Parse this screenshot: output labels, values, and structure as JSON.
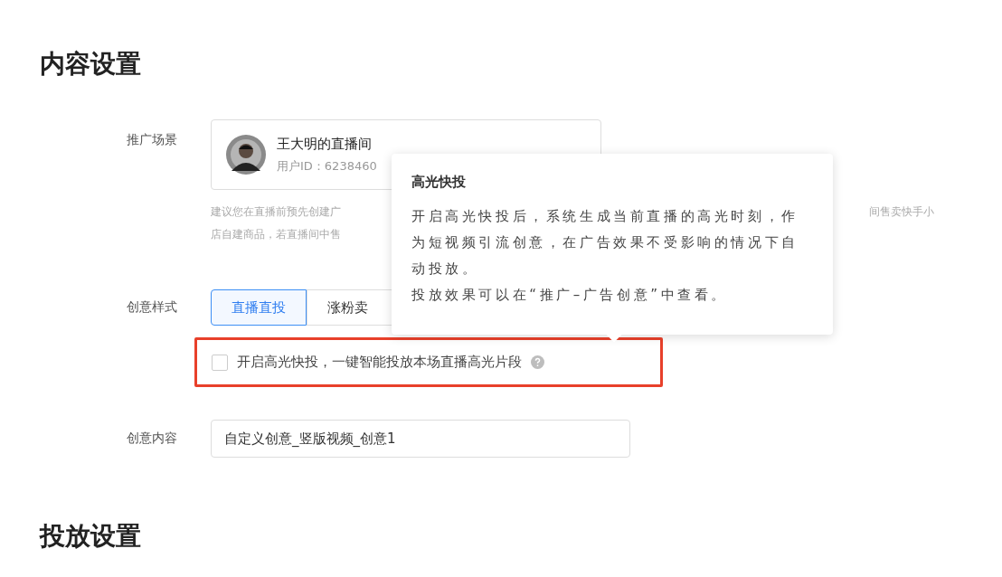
{
  "sections": [
    {
      "title": "内容设置"
    },
    {
      "title": "投放设置"
    }
  ],
  "scene": {
    "label": "推广场景",
    "name": "王大明的直播间",
    "user_id": "用户ID：6238460",
    "hint_lines": [
      [
        "建议您在直播前预先创建广",
        "间售卖快手小"
      ],
      [
        "店自建商品，若直播间中售"
      ]
    ]
  },
  "style": {
    "label": "创意样式",
    "tabs": [
      {
        "label": "直播直投",
        "selected": true
      },
      {
        "label": "涨粉卖",
        "selected": false
      }
    ]
  },
  "highlight_option": {
    "label": "开启高光快投，一键智能投放本场直播高光片段",
    "checked": false,
    "highlighted": true
  },
  "content": {
    "label": "创意内容",
    "value": "自定义创意_竖版视频_创意1"
  },
  "tooltip": {
    "title": "高光快投",
    "lines": [
      "开启高光快投后，系统生成当前直播的高光时刻，作为短视频引流创意，在广告效果不受影响的情况下自动投放。",
      "投放效果可以在“推广–广告创意”中查看。"
    ]
  }
}
